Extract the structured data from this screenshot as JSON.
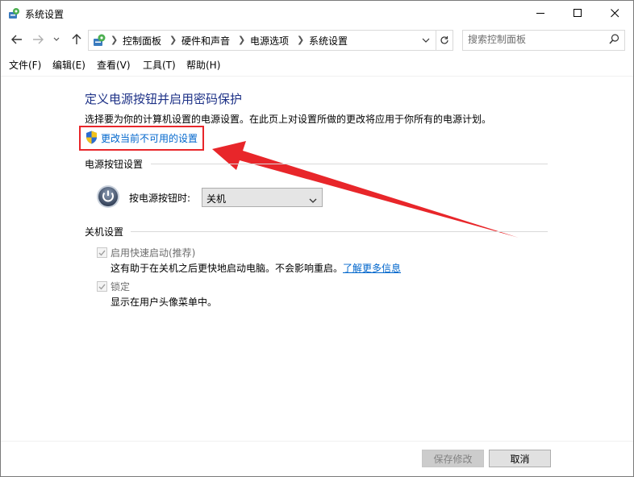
{
  "window": {
    "title": "系统设置",
    "controls": {
      "minimize": "minimize",
      "maximize": "maximize",
      "close": "close"
    }
  },
  "address_bar": {
    "breadcrumbs": [
      "控制面板",
      "硬件和声音",
      "电源选项",
      "系统设置"
    ]
  },
  "search": {
    "placeholder": "搜索控制面板"
  },
  "menu": {
    "items": [
      "文件(F)",
      "编辑(E)",
      "查看(V)",
      "工具(T)",
      "帮助(H)"
    ]
  },
  "content": {
    "title": "定义电源按钮并启用密码保护",
    "description": "选择要为你的计算机设置的电源设置。在此页上对设置所做的更改将应用于你所有的电源计划。",
    "change_link": "更改当前不可用的设置",
    "power_section": {
      "title": "电源按钮设置",
      "label": "按电源按钮时:",
      "selected": "关机"
    },
    "shutdown_section": {
      "title": "关机设置",
      "fast_startup": {
        "label": "启用快速启动(推荐)",
        "checked": true,
        "description": "这有助于在关机之后更快地启动电脑。不会影响重启。",
        "link": "了解更多信息"
      },
      "lock": {
        "label": "锁定",
        "checked": true,
        "description": "显示在用户头像菜单中。"
      }
    }
  },
  "buttons": {
    "save": "保存修改",
    "cancel": "取消"
  },
  "colors": {
    "title": "#1e3287",
    "link": "#0066cc",
    "highlight": "#e8262a",
    "disabled_text": "#838383"
  }
}
